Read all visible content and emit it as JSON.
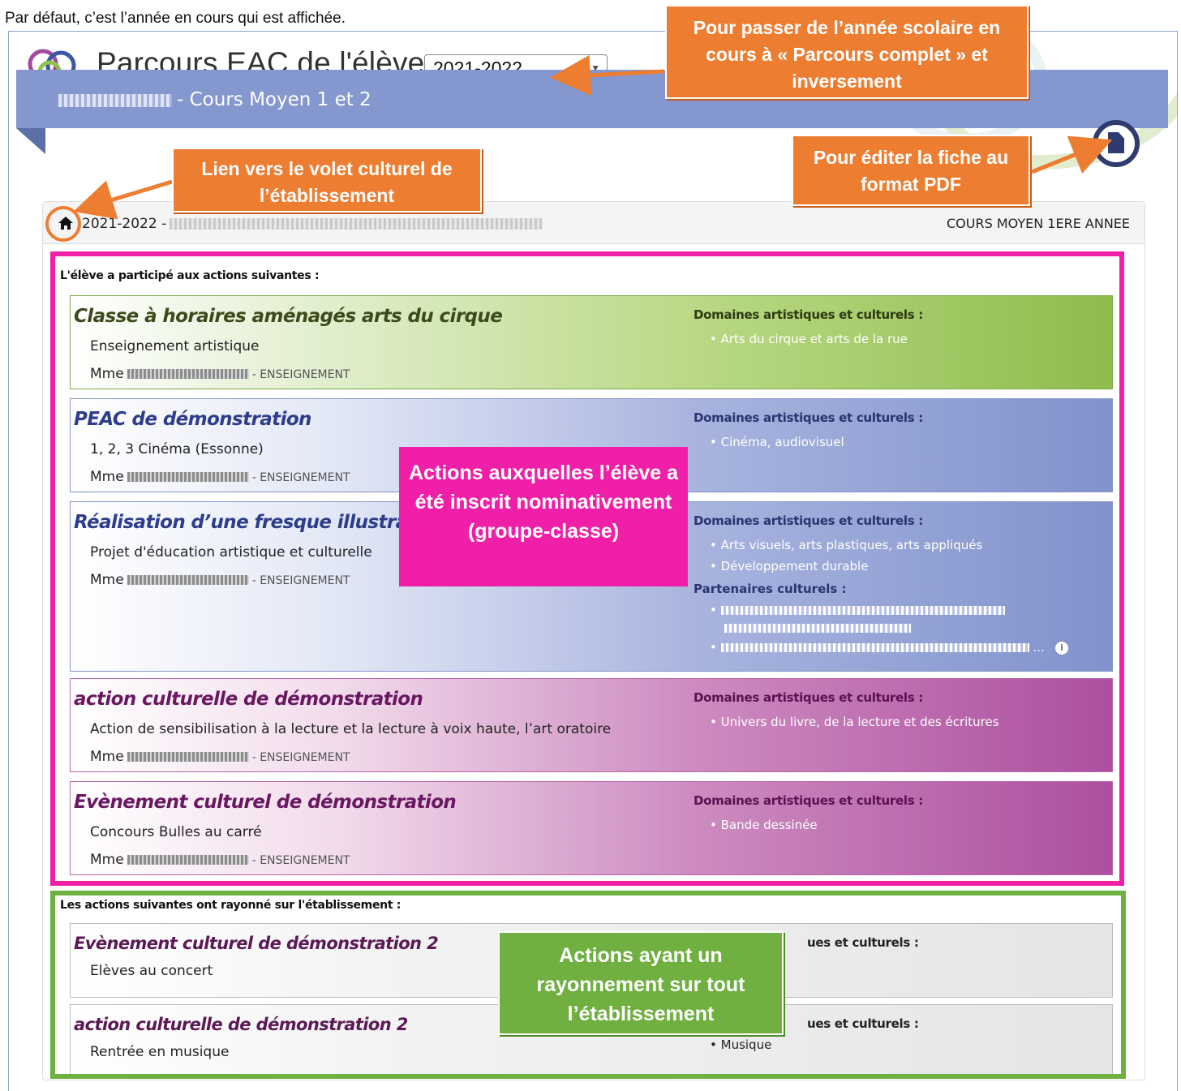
{
  "intro": "Par défaut, c’est l’année en cours qui est affichée.",
  "header": {
    "title": "Parcours EAC de l'élève",
    "year_selected": "2021-2022"
  },
  "banner": {
    "title_suffix": "- Cours Moyen 1 et 2"
  },
  "breadcrumb": {
    "year": "2021-2022 -",
    "level": "COURS MOYEN 1ERE ANNEE"
  },
  "section1_title": "L'élève a participé aux actions suivantes :",
  "section2_title": "Les actions suivantes ont rayonné sur l'établissement :",
  "labels": {
    "domains": "Domaines artistiques et culturels :",
    "partners": "Partenaires culturels :",
    "teacher_prefix": "Mme",
    "teacher_role": "- ENSEIGNEMENT",
    "domains_cut": "ues et culturels :"
  },
  "actions": [
    {
      "title": "Classe à horaires aménagés arts du cirque",
      "type": "Enseignement artistique",
      "domains": [
        "Arts du cirque et arts de la rue"
      ]
    },
    {
      "title": "PEAC de démonstration",
      "type": "1, 2, 3 Cinéma (Essonne)",
      "domains": [
        "Cinéma, audiovisuel"
      ]
    },
    {
      "title": "Réalisation d’une fresque illustrant une",
      "type": "Projet d'éducation artistique et culturelle",
      "domains": [
        "Arts visuels, arts plastiques, arts appliqués",
        "Développement durable"
      ],
      "partners_ellipsis": "..."
    },
    {
      "title": "action culturelle de démonstration",
      "type": "Action de sensibilisation à la lecture et la lecture à voix haute, l’art oratoire",
      "domains": [
        "Univers du livre, de la lecture et des écritures"
      ]
    },
    {
      "title": "Evènement culturel de démonstration",
      "type": "Concours Bulles au carré",
      "domains": [
        "Bande dessinée"
      ]
    }
  ],
  "school_actions": [
    {
      "title": "Evènement culturel de démonstration 2",
      "type": "Elèves au concert"
    },
    {
      "title": "action culturelle de démonstration 2",
      "type": "Rentrée en musique",
      "domains": [
        "Musique"
      ]
    }
  ],
  "callouts": {
    "year_switch": "Pour passer de l’année scolaire en cours à « Parcours complet » et inversement",
    "pdf": "Pour éditer la fiche au format PDF",
    "home_link": "Lien vers le volet culturel de l’établissement",
    "nominative": "Actions auxquelles l’élève a été inscrit nominativement (groupe-classe)",
    "school_wide": "Actions ayant un rayonnement sur tout l’établissement"
  },
  "colors": {
    "orange": "#ed7d31",
    "pink": "#f01fa8",
    "green": "#6fb040",
    "banner": "#8497cf"
  }
}
